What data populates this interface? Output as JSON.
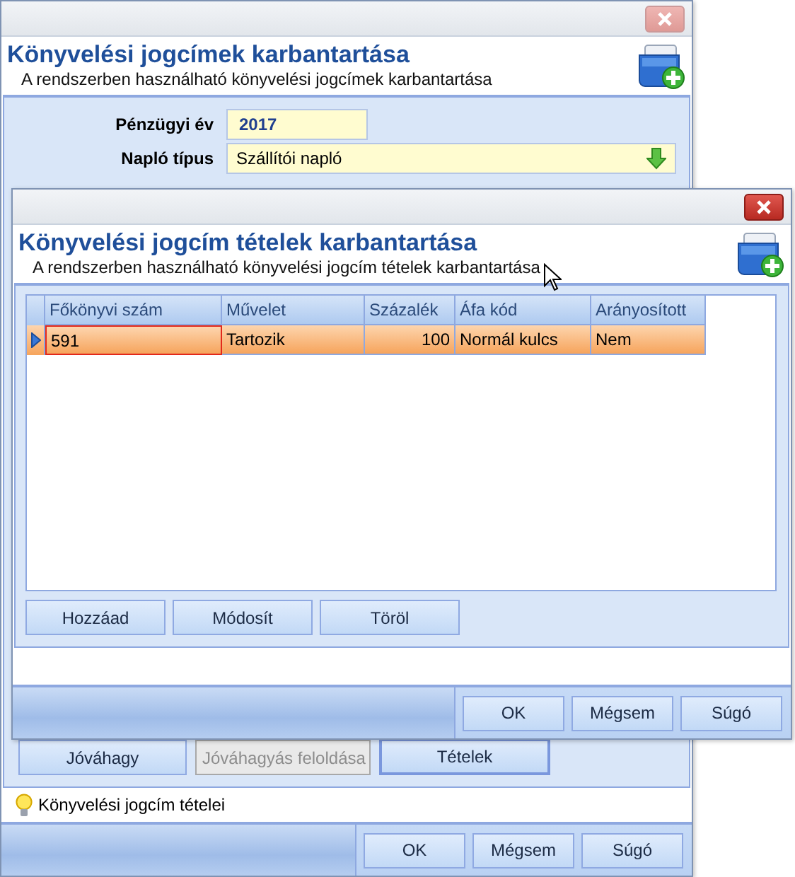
{
  "main_window": {
    "active": false,
    "title": "Könyvelési jogcímek karbantartása",
    "subtitle": "A rendszerben használható könyvelési jogcímek karbantartása",
    "fields": [
      {
        "label": "Pénzügyi év",
        "kind": "number",
        "value": "2017"
      },
      {
        "label": "Napló típus",
        "kind": "dropdown",
        "value": "Szállítói napló"
      }
    ],
    "buttons": [
      {
        "label": "Jóváhagy",
        "disabled": false,
        "default": false
      },
      {
        "label": "Jóváhagyás feloldása",
        "disabled": true,
        "default": false
      },
      {
        "label": "Tételek",
        "disabled": false,
        "default": true
      }
    ],
    "status": "Könyvelési jogcím tételei",
    "footer_buttons": [
      "OK",
      "Mégsem",
      "Súgó"
    ]
  },
  "item_dialog": {
    "active": true,
    "title": "Könyvelési jogcím tételek karbantartása",
    "subtitle": "A rendszerben használható könyvelési jogcím tételek karbantartása",
    "table": {
      "columns": [
        {
          "label": "Főkönyvi szám",
          "kind": "text"
        },
        {
          "label": "Művelet",
          "kind": "text"
        },
        {
          "label": "Százalék",
          "kind": "number"
        },
        {
          "label": "Áfa kód",
          "kind": "text"
        },
        {
          "label": "Arányosított",
          "kind": "text"
        }
      ],
      "rows": [
        {
          "selected": true,
          "cells": [
            {
              "text": "591",
              "focused": true
            },
            {
              "text": "Tartozik",
              "focused": false
            },
            {
              "text": "100",
              "focused": false
            },
            {
              "text": "Normál kulcs",
              "focused": false
            },
            {
              "text": "Nem",
              "focused": false
            }
          ]
        }
      ]
    },
    "buttons": [
      {
        "label": "Hozzáad",
        "disabled": false,
        "default": false
      },
      {
        "label": "Módosít",
        "disabled": false,
        "default": false
      },
      {
        "label": "Töröl",
        "disabled": false,
        "default": false
      }
    ],
    "footer_buttons": [
      "OK",
      "Mégsem",
      "Súgó"
    ]
  }
}
